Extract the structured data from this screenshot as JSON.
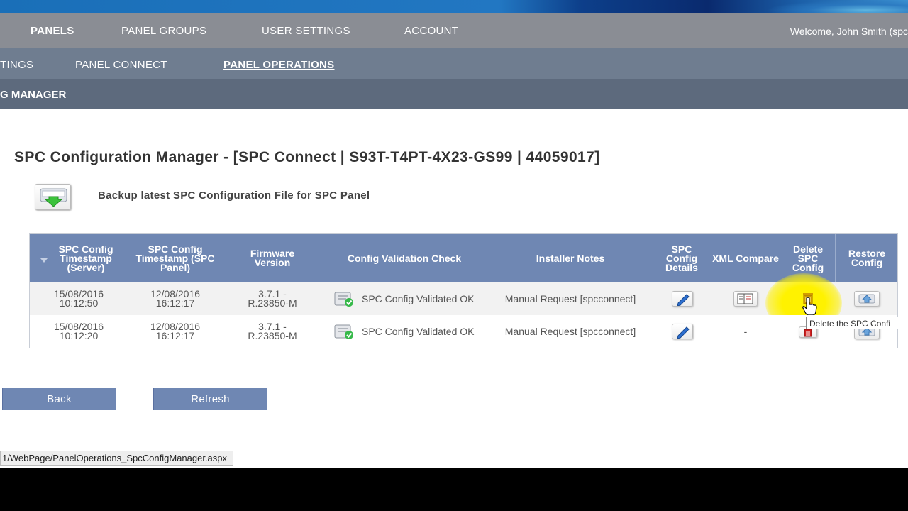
{
  "nav_primary": {
    "items": [
      "PANELS",
      "PANEL GROUPS",
      "USER SETTINGS",
      "ACCOUNT"
    ],
    "welcome": "Welcome, John Smith (spc"
  },
  "nav_secondary": {
    "items": [
      "TINGS",
      "PANEL CONNECT",
      "PANEL OPERATIONS"
    ]
  },
  "nav_tertiary": {
    "item": "G MANAGER"
  },
  "page": {
    "title": "SPC Configuration Manager - [SPC Connect | S93T-T4PT-4X23-GS99 | 44059017]",
    "backup_label": "Backup latest SPC Configuration File for SPC Panel"
  },
  "table": {
    "headers": {
      "timestamp_server": "SPC Config Timestamp (Server)",
      "timestamp_panel": "SPC Config Timestamp (SPC Panel)",
      "firmware": "Firmware Version",
      "validation": "Config Validation Check",
      "notes": "Installer Notes",
      "details": "SPC Config Details",
      "xml": "XML Compare",
      "delete": "Delete SPC Config",
      "restore": "Restore Config"
    },
    "rows": [
      {
        "timestamp_server": "15/08/2016 10:12:50",
        "timestamp_panel": "12/08/2016 16:12:17",
        "firmware": "3.7.1 - R.23850-M",
        "validation": "SPC Config Validated OK",
        "notes": "Manual Request [spcconnect]",
        "xml": ""
      },
      {
        "timestamp_server": "15/08/2016 10:12:20",
        "timestamp_panel": "12/08/2016 16:12:17",
        "firmware": "3.7.1 - R.23850-M",
        "validation": "SPC Config Validated OK",
        "notes": "Manual Request [spcconnect]",
        "xml": "-"
      }
    ]
  },
  "tooltip": "Delete the SPC Confi",
  "buttons": {
    "back": "Back",
    "refresh": "Refresh"
  },
  "status_url": "1/WebPage/PanelOperations_SpcConfigManager.aspx",
  "colors": {
    "header_bg": "#6f87b3",
    "nav1_bg": "#8a8d94",
    "nav2_bg": "#6f7d90",
    "nav3_bg": "#5d6a7d",
    "highlight": "#fff200"
  }
}
